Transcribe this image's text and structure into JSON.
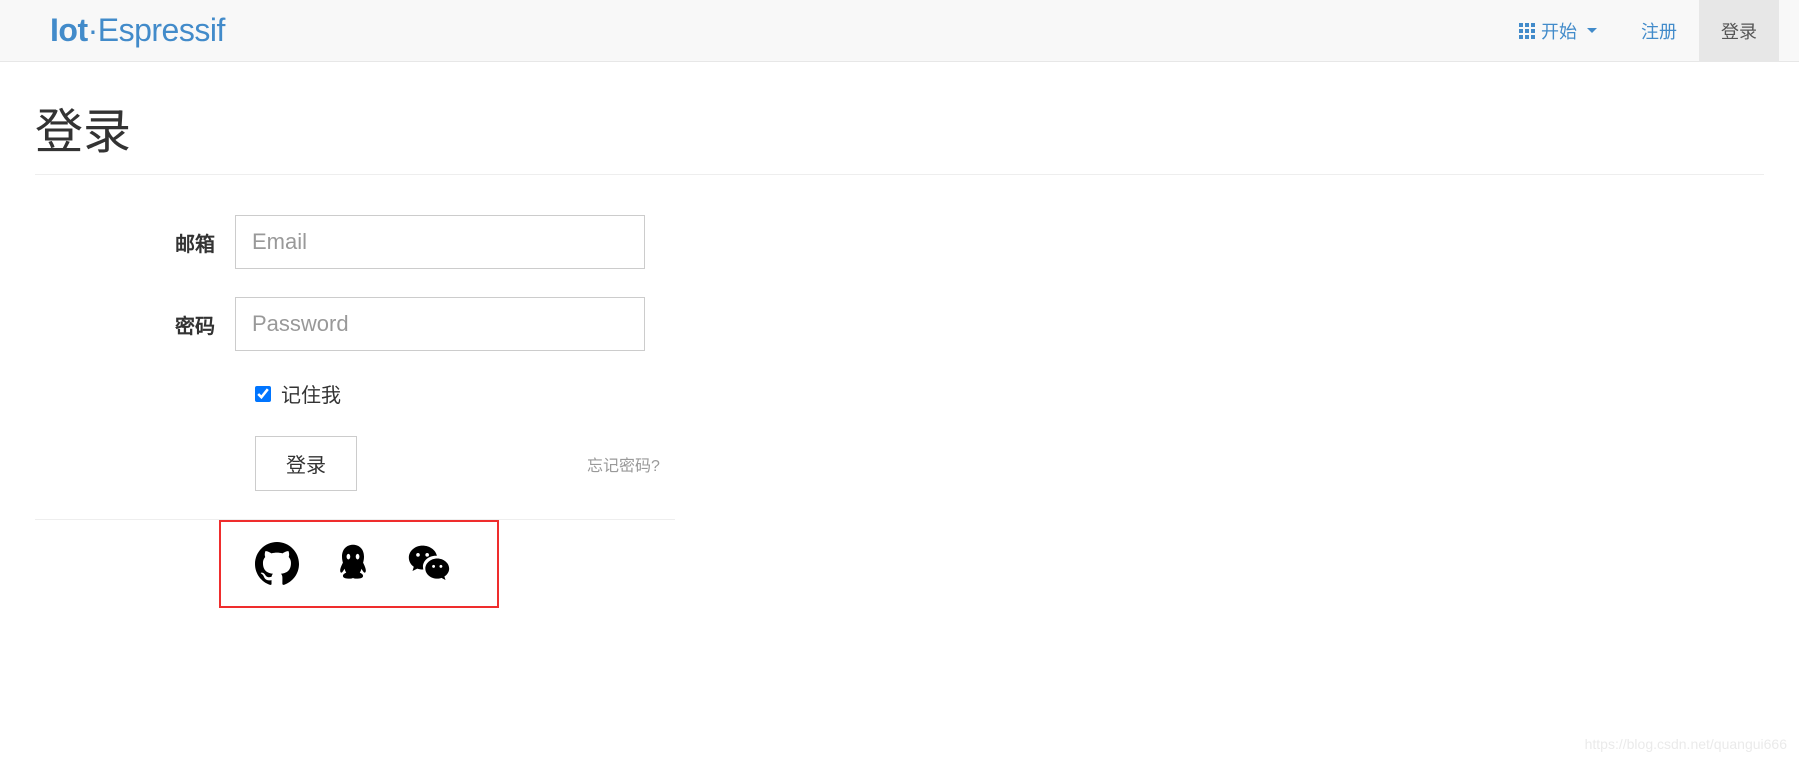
{
  "brand": {
    "bold": "Iot",
    "sep": "·",
    "light": "Espressif"
  },
  "nav": {
    "start": "开始",
    "register": "注册",
    "login": "登录"
  },
  "page": {
    "title": "登录"
  },
  "form": {
    "email_label": "邮箱",
    "email_placeholder": "Email",
    "email_value": "",
    "password_label": "密码",
    "password_placeholder": "Password",
    "password_value": "",
    "remember_label": "记住我",
    "remember_checked": true,
    "login_button": "登录",
    "forgot_link": "忘记密码?"
  },
  "social": {
    "github": "github-icon",
    "qq": "qq-icon",
    "wechat": "wechat-icon"
  },
  "watermark": "https://blog.csdn.net/quangui666"
}
